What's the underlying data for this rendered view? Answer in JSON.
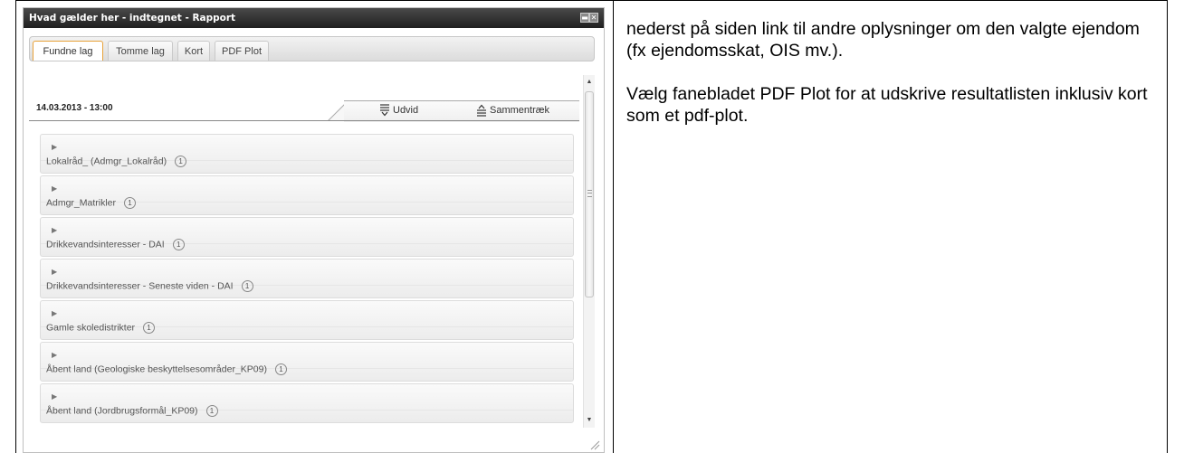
{
  "window": {
    "title": "Hvad gælder her - indtegnet - Rapport",
    "window_buttons": [
      "▬",
      "✕"
    ]
  },
  "tabs": [
    {
      "label": "Fundne lag",
      "active": true
    },
    {
      "label": "Tomme lag",
      "active": false
    },
    {
      "label": "Kort",
      "active": false
    },
    {
      "label": "PDF Plot",
      "active": false
    }
  ],
  "report": {
    "datetime": "14.03.2013 - 13:00",
    "expand_label": "Udvid",
    "collapse_label": "Sammentræk"
  },
  "layers": [
    {
      "name": "Lokalråd_ (Admgr_Lokalråd)",
      "count": "1"
    },
    {
      "name": "Admgr_Matrikler",
      "count": "1"
    },
    {
      "name": "Drikkevandsinteresser - DAI",
      "count": "1"
    },
    {
      "name": "Drikkevandsinteresser - Seneste viden - DAI",
      "count": "1"
    },
    {
      "name": "Gamle skoledistrikter",
      "count": "1"
    },
    {
      "name": "Åbent land (Geologiske beskyttelsesområder_KP09)",
      "count": "1"
    },
    {
      "name": "Åbent land (Jordbrugsformål_KP09)",
      "count": "1"
    }
  ],
  "scroll_glyphs": {
    "up": "▲",
    "down": "▼"
  },
  "doc_text": {
    "paragraph1": "nederst på siden link til andre oplysninger om den valgte ejendom (fx ejendomsskat, OIS mv.).",
    "paragraph2": "Vælg fanebladet PDF Plot for at udskrive resultatlisten inklusiv kort som et pdf-plot."
  },
  "colors": {
    "active_tab_border": "#e8a23a",
    "titlebar": "#2b2b2b"
  }
}
